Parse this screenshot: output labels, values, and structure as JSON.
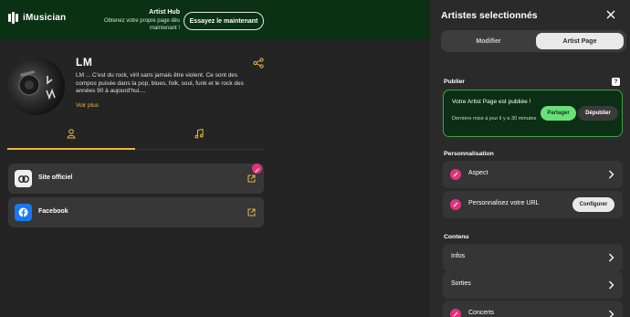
{
  "header": {
    "logo_text": "iMusician",
    "hub_title": "Artist Hub",
    "hub_desc": "Obtenez votre propre page dès maintenant !",
    "try_button": "Essayez le maintenant"
  },
  "artist": {
    "name": "LM",
    "bio": "LM ... C'est du rock, viril sans jamais être violent. Ce sont des compos puisée dans la pop, blues, folk, soul, funk et le rock des années 90 à aujourd'hui....",
    "voir_plus": "Voir plus"
  },
  "tabs": [
    {
      "icon": "user-icon",
      "active": true
    },
    {
      "icon": "music-note-icon",
      "active": false
    }
  ],
  "links": [
    {
      "label": "Site officiel",
      "icon": "link-icon"
    },
    {
      "label": "Facebook",
      "icon": "facebook-icon"
    }
  ],
  "panel": {
    "title": "Artistes selectionnés",
    "seg_modifier": "Modifier",
    "seg_artist_page": "Artist Page",
    "publier_label": "Publier",
    "help": "?",
    "publish_title": "Votre Artist Page est publiée !",
    "publish_sub": "Dernière mise à jour il y a 30 minutes",
    "btn_partager": "Partager",
    "btn_depublier": "Dépublier",
    "perso_label": "Personnalisation",
    "aspect": "Aspect",
    "url": "Personnalisez votre URL",
    "configurer": "Configurer",
    "contenu_label": "Contenu",
    "infos": "Infos",
    "sorties": "Sorties",
    "concerts": "Concerts"
  },
  "colors": {
    "accent_yellow": "#e8b93a",
    "brand_green": "#69e07a",
    "pink": "#e0337e",
    "facebook_blue": "#1877f2"
  }
}
